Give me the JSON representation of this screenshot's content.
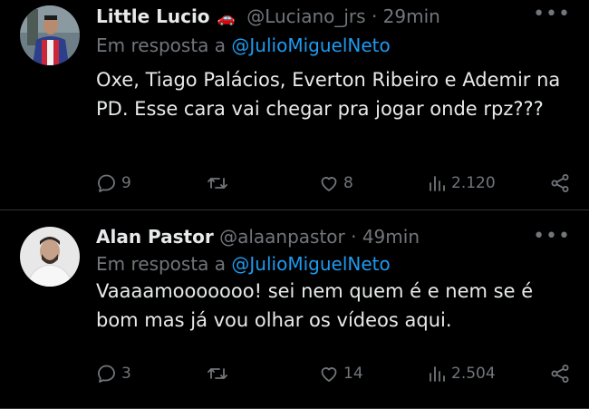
{
  "tweets": [
    {
      "name": "Little Lucio",
      "name_emoji": "🚗",
      "handle": "@Luciano_jrs",
      "separator": "·",
      "time": "29min",
      "reply_prefix": "Em resposta a ",
      "reply_to": "@JulioMiguelNeto",
      "text": "Oxe, Tiago Palácios, Everton Ribeiro e Ademir na PD. Esse cara vai chegar pra jogar onde rpz???",
      "replies": "9",
      "retweets": "",
      "likes": "8",
      "views": "2.120"
    },
    {
      "name": "Alan Pastor",
      "handle": "@alaanpastor",
      "separator": "·",
      "time": "49min",
      "reply_prefix": "Em resposta a ",
      "reply_to": "@JulioMiguelNeto",
      "text": "Vaaaamooooooo! sei nem quem é e nem se é bom mas já vou olhar os vídeos aqui.",
      "replies": "3",
      "retweets": "",
      "likes": "14",
      "views": "2.504"
    }
  ],
  "icons": {
    "more": "more-icon",
    "reply": "reply-icon",
    "retweet": "retweet-icon",
    "like": "heart-icon",
    "views": "views-icon",
    "share": "share-icon"
  },
  "colors": {
    "background": "#000000",
    "text": "#e7e9ea",
    "secondary": "#71767b",
    "mention": "#1d9bf0",
    "divider": "#2f3336"
  }
}
